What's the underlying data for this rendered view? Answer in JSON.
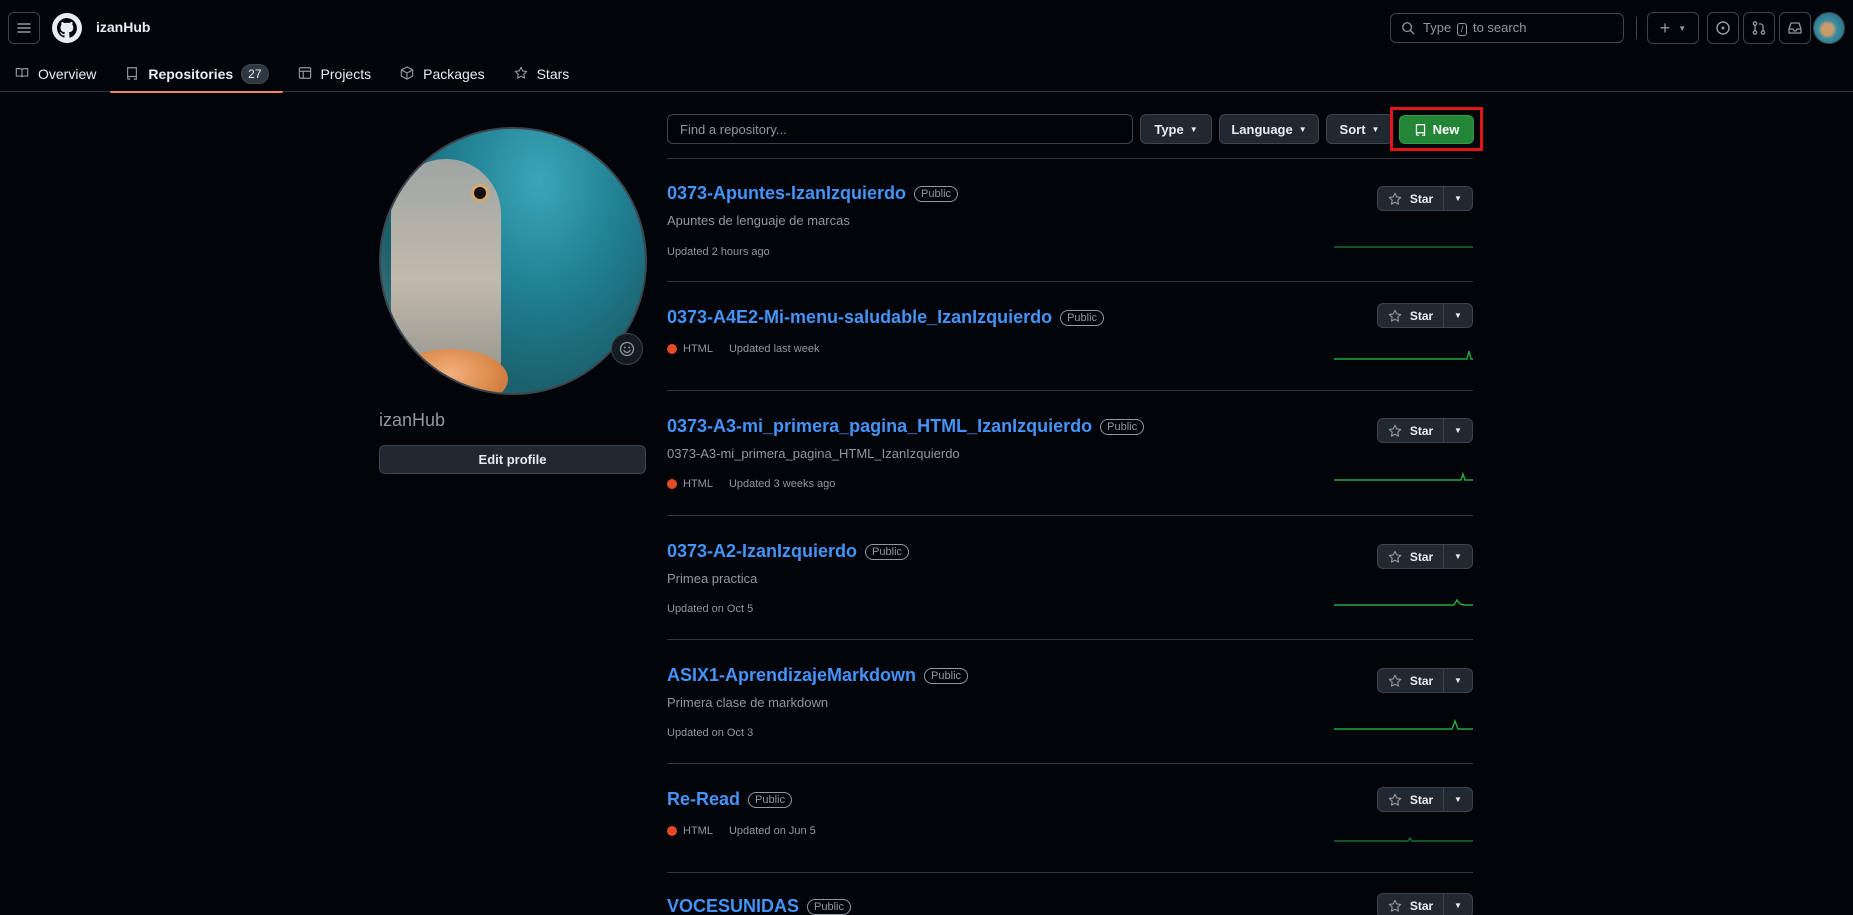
{
  "header": {
    "username": "izanHub",
    "search_prefix": "Type",
    "search_key": "/",
    "search_suffix": "to search"
  },
  "tabs": [
    {
      "label": "Overview",
      "icon": "book-icon"
    },
    {
      "label": "Repositories",
      "icon": "repo-icon",
      "count": "27",
      "active": true
    },
    {
      "label": "Projects",
      "icon": "table-icon"
    },
    {
      "label": "Packages",
      "icon": "package-icon"
    },
    {
      "label": "Stars",
      "icon": "star-icon"
    }
  ],
  "profile": {
    "name": "izanHub",
    "edit_label": "Edit profile"
  },
  "filters": {
    "find_placeholder": "Find a repository...",
    "type_label": "Type",
    "language_label": "Language",
    "sort_label": "Sort",
    "new_label": "New"
  },
  "colors": {
    "accent_link": "#4493f8",
    "new_button": "#238636",
    "highlight_box": "#e5141b",
    "html_language": "#e34c26",
    "active_tab_underline": "#f78166"
  },
  "repos": [
    {
      "name": "0373-Apuntes-IzanIzquierdo",
      "visibility": "Public",
      "description": "Apuntes de lenguaje de marcas",
      "language": "",
      "updated": "Updated 2 hours ago",
      "star_label": "Star"
    },
    {
      "name": "0373-A4E2-Mi-menu-saludable_IzanIzquierdo",
      "visibility": "Public",
      "description": "",
      "language": "HTML",
      "updated": "Updated last week",
      "star_label": "Star"
    },
    {
      "name": "0373-A3-mi_primera_pagina_HTML_IzanIzquierdo",
      "visibility": "Public",
      "description": "0373-A3-mi_primera_pagina_HTML_IzanIzquierdo",
      "language": "HTML",
      "updated": "Updated 3 weeks ago",
      "star_label": "Star"
    },
    {
      "name": "0373-A2-IzanIzquierdo",
      "visibility": "Public",
      "description": "Primea practica",
      "language": "",
      "updated": "Updated on Oct 5",
      "star_label": "Star"
    },
    {
      "name": "ASIX1-AprendizajeMarkdown",
      "visibility": "Public",
      "description": "Primera clase de markdown",
      "language": "",
      "updated": "Updated on Oct 3",
      "star_label": "Star"
    },
    {
      "name": "Re-Read",
      "visibility": "Public",
      "description": "",
      "language": "HTML",
      "updated": "Updated on Jun 5",
      "star_label": "Star"
    },
    {
      "name": "VOCESUNIDAS",
      "visibility": "Public",
      "description": "",
      "language": "",
      "updated": "",
      "star_label": "Star"
    }
  ]
}
